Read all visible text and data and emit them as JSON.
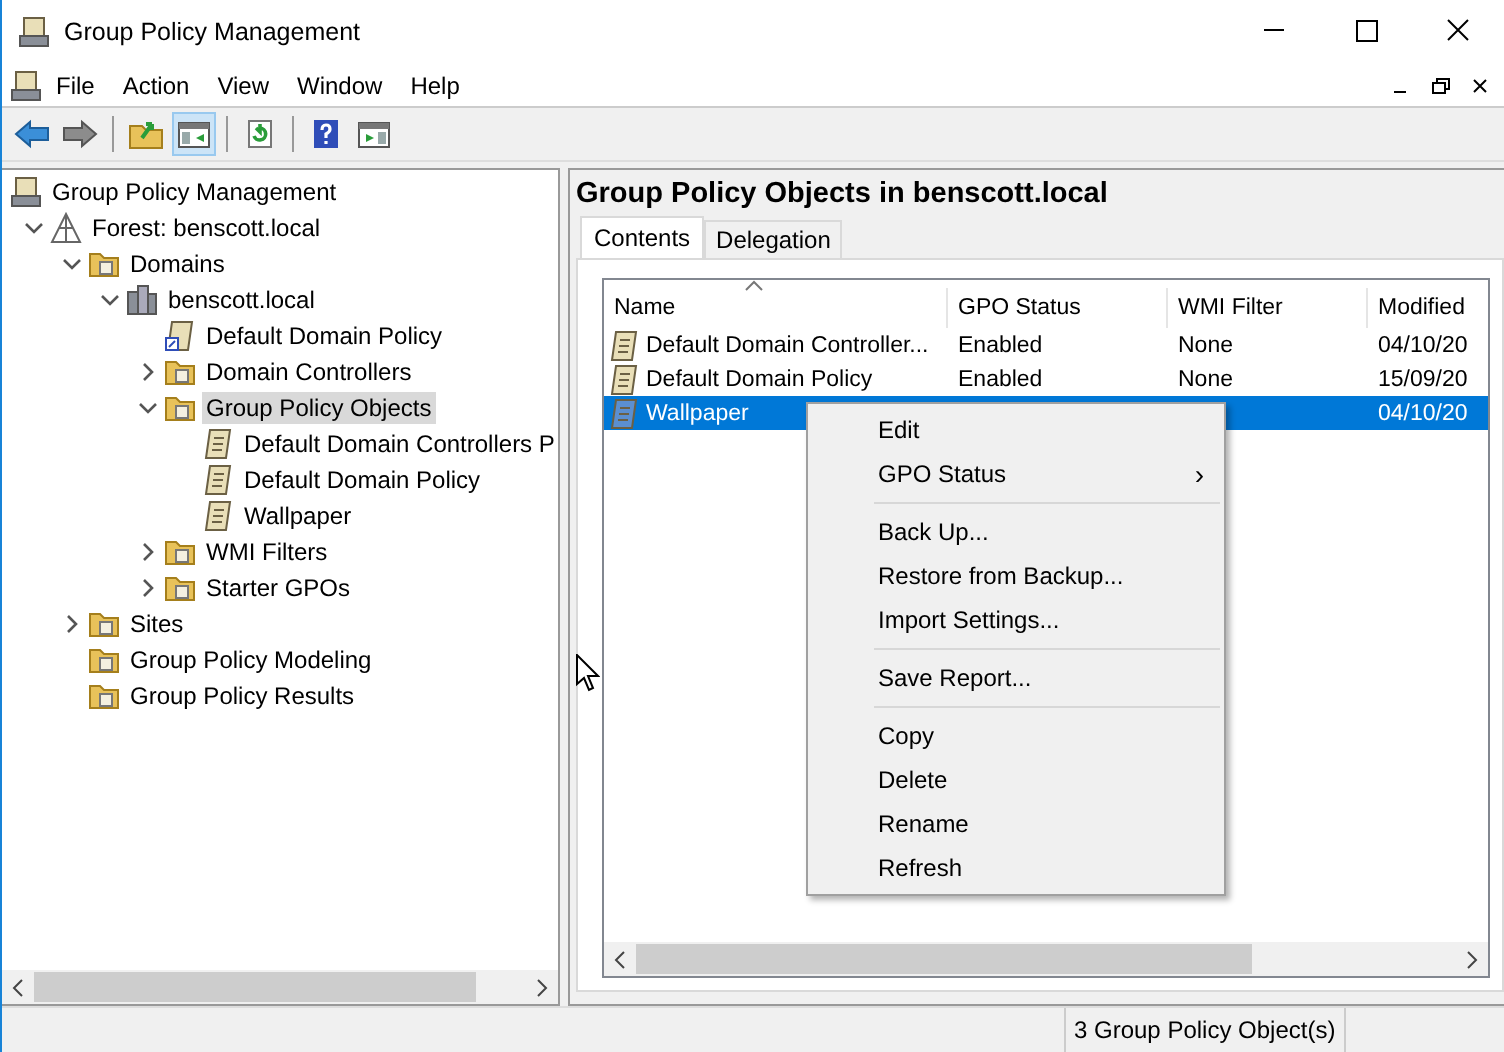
{
  "window": {
    "title": "Group Policy Management"
  },
  "menu": [
    "File",
    "Action",
    "View",
    "Window",
    "Help"
  ],
  "toolbar": [
    {
      "kind": "back",
      "pressed": false
    },
    {
      "kind": "forward",
      "pressed": false
    },
    {
      "kind": "up",
      "pressed": false
    },
    {
      "kind": "tree",
      "pressed": true
    },
    {
      "kind": "refresh",
      "pressed": false
    },
    {
      "kind": "help",
      "pressed": false
    },
    {
      "kind": "pane",
      "pressed": false
    }
  ],
  "tree": [
    {
      "label": "Group Policy Management",
      "kind": "console",
      "selected": false,
      "children": [
        {
          "label": "Forest: benscott.local",
          "kind": "forest",
          "expanded": true,
          "selected": false,
          "children": [
            {
              "label": "Domains",
              "kind": "folder",
              "expanded": true,
              "selected": false,
              "children": [
                {
                  "label": "benscott.local",
                  "kind": "domain",
                  "expanded": true,
                  "selected": false,
                  "children": [
                    {
                      "label": "Default Domain Policy",
                      "kind": "link",
                      "selected": false
                    },
                    {
                      "label": "Domain Controllers",
                      "kind": "folder",
                      "expanded": false,
                      "selected": false
                    },
                    {
                      "label": "Group Policy Objects",
                      "kind": "folder",
                      "expanded": true,
                      "selected": true,
                      "children": [
                        {
                          "label": "Default Domain Controllers P",
                          "kind": "scroll",
                          "selected": false
                        },
                        {
                          "label": "Default Domain Policy",
                          "kind": "scroll",
                          "selected": false
                        },
                        {
                          "label": "Wallpaper",
                          "kind": "scroll",
                          "selected": false
                        }
                      ]
                    },
                    {
                      "label": "WMI Filters",
                      "kind": "folder",
                      "expanded": false,
                      "selected": false
                    },
                    {
                      "label": "Starter GPOs",
                      "kind": "folder",
                      "expanded": false,
                      "selected": false
                    }
                  ]
                }
              ]
            },
            {
              "label": "Sites",
              "kind": "folder",
              "expanded": false,
              "selected": false
            },
            {
              "label": "Group Policy Modeling",
              "kind": "folder",
              "selected": false
            },
            {
              "label": "Group Policy Results",
              "kind": "folder",
              "selected": false
            }
          ]
        }
      ]
    }
  ],
  "details": {
    "title": "Group Policy Objects in benscott.local",
    "tabs": [
      {
        "label": "Contents",
        "selected": true
      },
      {
        "label": "Delegation",
        "selected": false
      }
    ],
    "columns": [
      "Name",
      "GPO Status",
      "WMI Filter",
      "Modified"
    ],
    "rows": [
      {
        "name": "Default Domain Controller...",
        "status": "Enabled",
        "wmi": "None",
        "modified": "04/10/20",
        "selected": false
      },
      {
        "name": "Default Domain Policy",
        "status": "Enabled",
        "wmi": "None",
        "modified": "15/09/20",
        "selected": false
      },
      {
        "name": "Wallpaper",
        "modified": "04/10/20",
        "selected": true
      }
    ]
  },
  "context_menu": [
    {
      "kind": "item",
      "label": "Edit"
    },
    {
      "kind": "submenu",
      "label": "GPO Status",
      "arrow": "›"
    },
    {
      "kind": "separator"
    },
    {
      "kind": "item",
      "label": "Back Up..."
    },
    {
      "kind": "item",
      "label": "Restore from Backup..."
    },
    {
      "kind": "item",
      "label": "Import Settings..."
    },
    {
      "kind": "separator"
    },
    {
      "kind": "item",
      "label": "Save Report..."
    },
    {
      "kind": "separator"
    },
    {
      "kind": "item",
      "label": "Copy"
    },
    {
      "kind": "item",
      "label": "Delete"
    },
    {
      "kind": "item",
      "label": "Rename"
    },
    {
      "kind": "item",
      "label": "Refresh"
    }
  ],
  "status_bar": "3 Group Policy Object(s)"
}
